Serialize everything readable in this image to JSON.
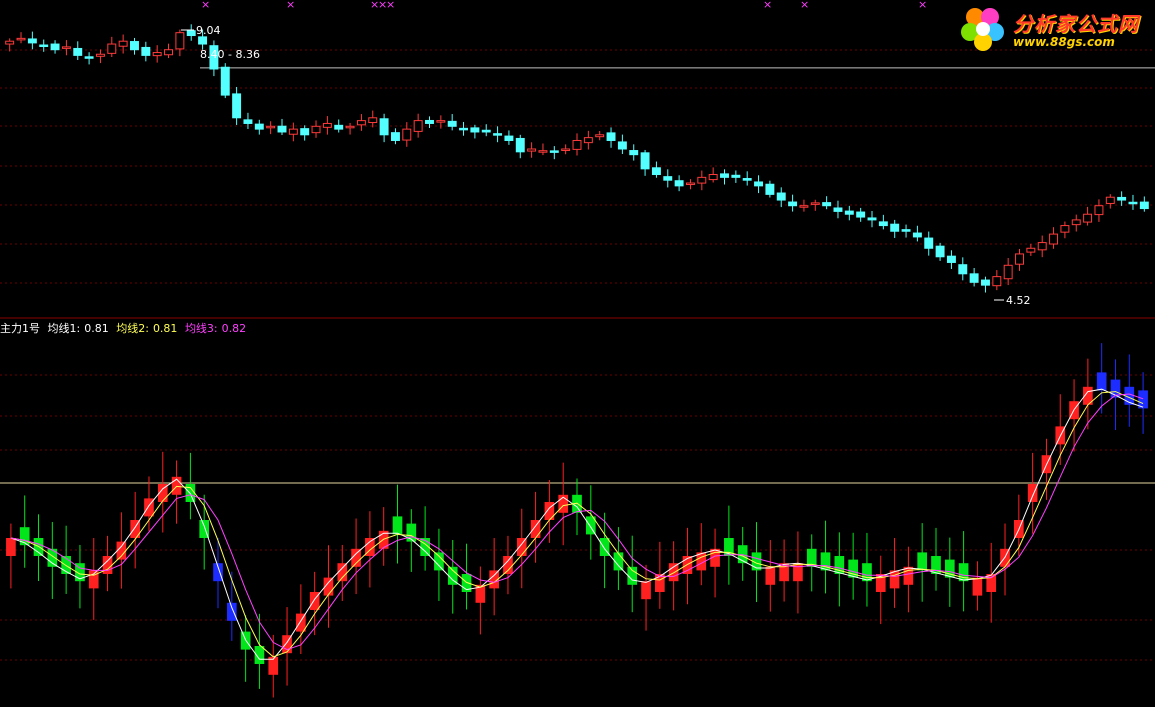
{
  "colors": {
    "up": "#ff3b3b",
    "down": "#54ffff",
    "ind_up": "#ff2020",
    "ind_down": "#00e61b",
    "ind_blue": "#1d2cff",
    "ma1": "#ffffff",
    "ma2": "#ffff55",
    "ma3": "#ff40ff",
    "hline_top": "#c0c0c0",
    "hline_bottom": "#e8d9a0",
    "grid": "#6a0000"
  },
  "logo": {
    "title": "分析家公式网",
    "url": "www.88gs.com",
    "icon": "flower-icon"
  },
  "price_panel": {
    "high_label": "9.04",
    "range_label": "8.40 - 8.36",
    "low_label": "4.52",
    "markers": "×"
  },
  "indicator_panel": {
    "name": "主力1号",
    "ma1_label": "均线1:",
    "ma1_value": "0.81",
    "ma2_label": "均线2:",
    "ma2_value": "0.81",
    "ma3_label": "均线3:",
    "ma3_value": "0.82"
  },
  "chart_data": [
    {
      "type": "candlestick",
      "title": "",
      "ylim": [
        4.2,
        9.4
      ],
      "annotations": [
        {
          "text": "9.04",
          "value": 9.04
        },
        {
          "text": "8.40 - 8.36",
          "value": 8.38
        },
        {
          "text": "4.52",
          "value": 4.52
        }
      ],
      "close_series": [
        8.85,
        8.9,
        8.82,
        8.78,
        8.7,
        8.75,
        8.6,
        8.55,
        8.62,
        8.8,
        8.85,
        8.7,
        8.6,
        8.65,
        8.7,
        9.0,
        8.95,
        8.8,
        8.36,
        7.9,
        7.5,
        7.4,
        7.3,
        7.35,
        7.25,
        7.3,
        7.2,
        7.35,
        7.4,
        7.3,
        7.35,
        7.45,
        7.5,
        7.2,
        7.1,
        7.3,
        7.45,
        7.4,
        7.45,
        7.35,
        7.3,
        7.25,
        7.25,
        7.2,
        7.1,
        6.9,
        6.95,
        6.92,
        6.9,
        6.95,
        7.1,
        7.15,
        7.2,
        7.1,
        6.95,
        6.85,
        6.6,
        6.5,
        6.4,
        6.3,
        6.35,
        6.45,
        6.5,
        6.45,
        6.45,
        6.4,
        6.3,
        6.15,
        6.05,
        5.95,
        5.95,
        6.0,
        5.95,
        5.85,
        5.8,
        5.75,
        5.7,
        5.6,
        5.5,
        5.5,
        5.4,
        5.2,
        5.05,
        4.95,
        4.75,
        4.6,
        4.55,
        4.7,
        4.9,
        5.1,
        5.2,
        5.3,
        5.45,
        5.6,
        5.7,
        5.8,
        5.95,
        6.1,
        6.05,
        6.0,
        5.9
      ]
    },
    {
      "type": "candlestick",
      "title": "主力1号",
      "series": [
        {
          "name": "均线1",
          "last": 0.81
        },
        {
          "name": "均线2",
          "last": 0.81
        },
        {
          "name": "均线3",
          "last": 0.82
        }
      ],
      "reference_line": 0.6,
      "ylim": [
        0.0,
        1.0
      ],
      "ma_series": [
        0.45,
        0.43,
        0.4,
        0.37,
        0.35,
        0.33,
        0.36,
        0.4,
        0.44,
        0.5,
        0.56,
        0.6,
        0.62,
        0.55,
        0.45,
        0.33,
        0.22,
        0.14,
        0.1,
        0.12,
        0.18,
        0.24,
        0.3,
        0.34,
        0.38,
        0.42,
        0.45,
        0.47,
        0.46,
        0.44,
        0.4,
        0.36,
        0.32,
        0.3,
        0.32,
        0.36,
        0.4,
        0.45,
        0.5,
        0.55,
        0.57,
        0.52,
        0.46,
        0.4,
        0.36,
        0.32,
        0.33,
        0.35,
        0.38,
        0.4,
        0.41,
        0.42,
        0.4,
        0.38,
        0.36,
        0.37,
        0.38,
        0.38,
        0.37,
        0.36,
        0.35,
        0.34,
        0.33,
        0.35,
        0.36,
        0.37,
        0.36,
        0.35,
        0.34,
        0.33,
        0.34,
        0.35,
        0.42,
        0.5,
        0.6,
        0.68,
        0.76,
        0.83,
        0.87,
        0.86,
        0.84,
        0.82,
        0.81
      ]
    }
  ]
}
